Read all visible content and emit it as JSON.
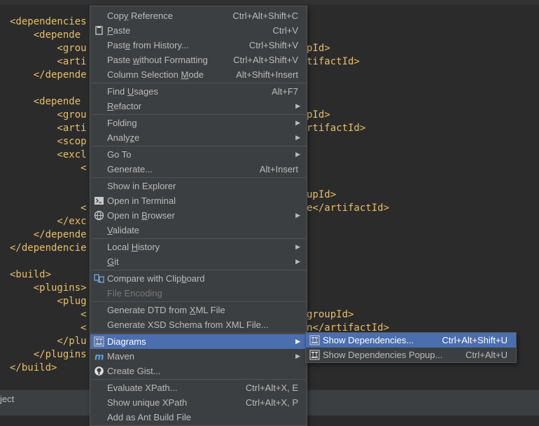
{
  "editor": {
    "lines": [
      "<dependencies",
      "    <depende",
      "        <grou",
      "        <arti",
      "    </depende",
      "",
      "    <depende",
      "        <grou",
      "        <arti",
      "        <scop",
      "        <excl",
      "            <",
      "",
      "",
      "            <",
      "        </exc",
      "    </depende",
      "</dependencie",
      "",
      "<build>",
      "    <plugins>",
      "        <plug",
      "            <",
      "            <",
      "        </plu",
      "    </plugins",
      "</build>"
    ],
    "right_fragments": [
      {
        "line": 2,
        "text": "pId>"
      },
      {
        "line": 3,
        "text": "tifactId>"
      },
      {
        "line": 7,
        "text": "pId>"
      },
      {
        "line": 8,
        "text": "rtifactId>"
      },
      {
        "line": 13,
        "text": "upId>"
      },
      {
        "line": 14,
        "text": "e</artifactId>"
      },
      {
        "line": 22,
        "text": "groupId>"
      },
      {
        "line": 23,
        "text": "n</artifactId>"
      }
    ],
    "colors": {
      "tag": "#e8bf6a",
      "text": "#a9b7c6"
    }
  },
  "status": {
    "text": "ject"
  },
  "context_menu": {
    "items": [
      {
        "label": "Copy Reference",
        "mn": "y",
        "shortcut": "Ctrl+Alt+Shift+C"
      },
      {
        "label": "Paste",
        "mn": "P",
        "shortcut": "Ctrl+V",
        "icon": "paste-icon"
      },
      {
        "label": "Paste from History...",
        "mn": "e",
        "shortcut": "Ctrl+Shift+V"
      },
      {
        "label": "Paste without Formatting",
        "mn": "w",
        "shortcut": "Ctrl+Alt+Shift+V"
      },
      {
        "label": "Column Selection Mode",
        "mn": "M",
        "shortcut": "Alt+Shift+Insert"
      },
      {
        "sep": true
      },
      {
        "label": "Find Usages",
        "mn": "U",
        "shortcut": "Alt+F7"
      },
      {
        "label": "Refactor",
        "mn": "R",
        "submenu": true
      },
      {
        "sep": true
      },
      {
        "label": "Folding",
        "submenu": true
      },
      {
        "label": "Analyze",
        "mn": "z",
        "submenu": true
      },
      {
        "sep": true
      },
      {
        "label": "Go To",
        "submenu": true
      },
      {
        "label": "Generate...",
        "shortcut": "Alt+Insert"
      },
      {
        "sep": true
      },
      {
        "label": "Show in Explorer"
      },
      {
        "label": "Open in Terminal",
        "icon": "terminal-icon"
      },
      {
        "label": "Open in Browser",
        "mn": "B",
        "submenu": true,
        "icon": "globe-icon"
      },
      {
        "label": "Validate",
        "mn": "V"
      },
      {
        "sep": true
      },
      {
        "label": "Local History",
        "mn": "H",
        "submenu": true
      },
      {
        "label": "Git",
        "mn": "G",
        "submenu": true
      },
      {
        "sep": true
      },
      {
        "label": "Compare with Clipboard",
        "mn": "b",
        "icon": "compare-icon"
      },
      {
        "label": "File Encoding",
        "disabled": true
      },
      {
        "sep": true
      },
      {
        "label": "Generate DTD from XML File",
        "mn": "X"
      },
      {
        "label": "Generate XSD Schema from XML File..."
      },
      {
        "sep": true
      },
      {
        "label": "Diagrams",
        "submenu": true,
        "selected": true,
        "icon": "diagram-icon"
      },
      {
        "label": "Maven",
        "submenu": true,
        "icon": "maven-icon"
      },
      {
        "label": "Create Gist...",
        "icon": "github-icon"
      },
      {
        "sep": true
      },
      {
        "label": "Evaluate XPath...",
        "shortcut": "Ctrl+Alt+X, E"
      },
      {
        "label": "Show unique XPath",
        "shortcut": "Ctrl+Alt+X, P"
      },
      {
        "label": "Add as Ant Build File"
      }
    ]
  },
  "diagrams_submenu": {
    "items": [
      {
        "label": "Show Dependencies...",
        "shortcut": "Ctrl+Alt+Shift+U",
        "selected": true,
        "icon": "diagram-icon"
      },
      {
        "label": "Show Dependencies Popup...",
        "shortcut": "Ctrl+Alt+U",
        "icon": "diagram-icon"
      }
    ]
  }
}
